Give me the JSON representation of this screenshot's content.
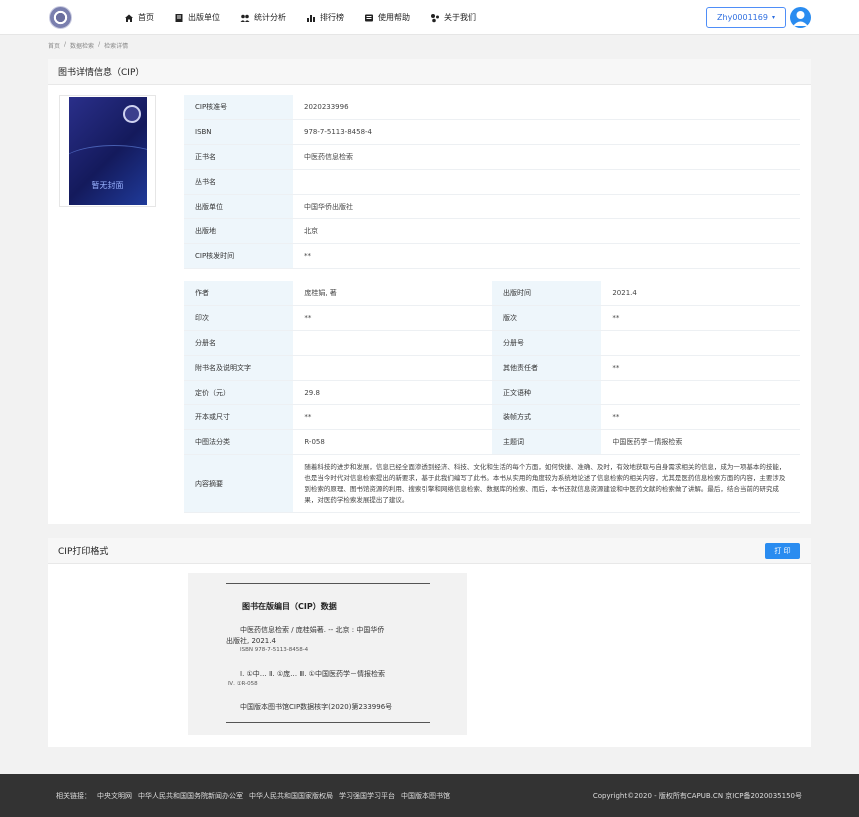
{
  "nav": {
    "items": [
      {
        "icon": "home-icon",
        "label": "首页"
      },
      {
        "icon": "book-icon",
        "label": "出版单位"
      },
      {
        "icon": "stats-icon",
        "label": "统计分析"
      },
      {
        "icon": "ranking-icon",
        "label": "排行榜"
      },
      {
        "icon": "help-icon",
        "label": "使用帮助"
      },
      {
        "icon": "about-icon",
        "label": "关于我们"
      }
    ],
    "user": "Zhy0001169"
  },
  "breadcrumb": [
    "首页",
    "数据检索",
    "检索详情"
  ],
  "detail": {
    "title": "图书详情信息（CIP）",
    "cover_text": "暂无封面",
    "rows1": [
      {
        "label": "CIP核准号",
        "value": "2020233996"
      },
      {
        "label": "ISBN",
        "value": "978-7-5113-8458-4"
      },
      {
        "label": "正书名",
        "value": "中医药信息检索"
      },
      {
        "label": "丛书名",
        "value": ""
      },
      {
        "label": "出版单位",
        "value": "中国华侨出版社"
      },
      {
        "label": "出版地",
        "value": "北京"
      },
      {
        "label": "CIP核发时间",
        "value": "**"
      }
    ],
    "rows2": [
      {
        "l1": "作者",
        "v1": "庞桂娟, 著",
        "l2": "出版时间",
        "v2": "2021.4"
      },
      {
        "l1": "印次",
        "v1": "**",
        "l2": "版次",
        "v2": "**"
      },
      {
        "l1": "分册名",
        "v1": "",
        "l2": "分册号",
        "v2": ""
      },
      {
        "l1": "附书名及说明文字",
        "v1": "",
        "l2": "其他责任者",
        "v2": "**"
      },
      {
        "l1": "定价（元）",
        "v1": "29.8",
        "l2": "正文语种",
        "v2": ""
      },
      {
        "l1": "开本或尺寸",
        "v1": "**",
        "l2": "装帧方式",
        "v2": "**"
      },
      {
        "l1": "中图法分类",
        "v1": "R-058",
        "l2": "主题词",
        "v2": "中国医药学－情报检索"
      }
    ],
    "abstract_label": "内容摘要",
    "abstract": "随着科技的进步和发展，信息已经全面渗透到经济、科技、文化和生活的每个方面，如何快捷、准确、及时，有效地获取与自身需求相关的信息，成为一项基本的技能，也是当今时代对信息检索提出的新要求，基于此我们编写了此书。本书从实用的角度较为系统地论述了信息检索的相关内容，尤其是医药信息检索方面的内容，主要涉及到检索的原理、图书馆资源的利用、搜索引擎和网络信息检索、数据库的检索、而后，本书还就信息资源建设和中医药文献的检索做了讲解。最后，结合当前的研究成果，对医药学检索发展提出了建议。"
  },
  "cip": {
    "title": "CIP打印格式",
    "print_button": "打 印",
    "card_title": "图书在版编目（CIP）数据",
    "line1": "中医药信息检索 / 庞桂娟著. -- 北京 : 中国华侨",
    "line2": "出版社, 2021.4",
    "line3": "ISBN 978-7-5113-8458-4",
    "line4": "Ⅰ. ①中… Ⅱ. ①庞… Ⅲ. ①中国医药学－情报检索",
    "line5": "Ⅳ. ①R-058",
    "line6": "中国版本图书馆CIP数据核字(2020)第233996号"
  },
  "footer": {
    "links_label": "相关链接：",
    "links": [
      "中央文明网",
      "中华人民共和国国务院新闻办公室",
      "中华人民共和国国家版权局",
      "学习强国学习平台",
      "中国版本图书馆"
    ],
    "copyright": "Copyright©2020 - 版权所有CAPUB.CN 京ICP备2020035150号"
  },
  "colors": {
    "accent": "#2a8cf0",
    "label_bg": "#eef6fb",
    "footer_bg": "#333333"
  }
}
